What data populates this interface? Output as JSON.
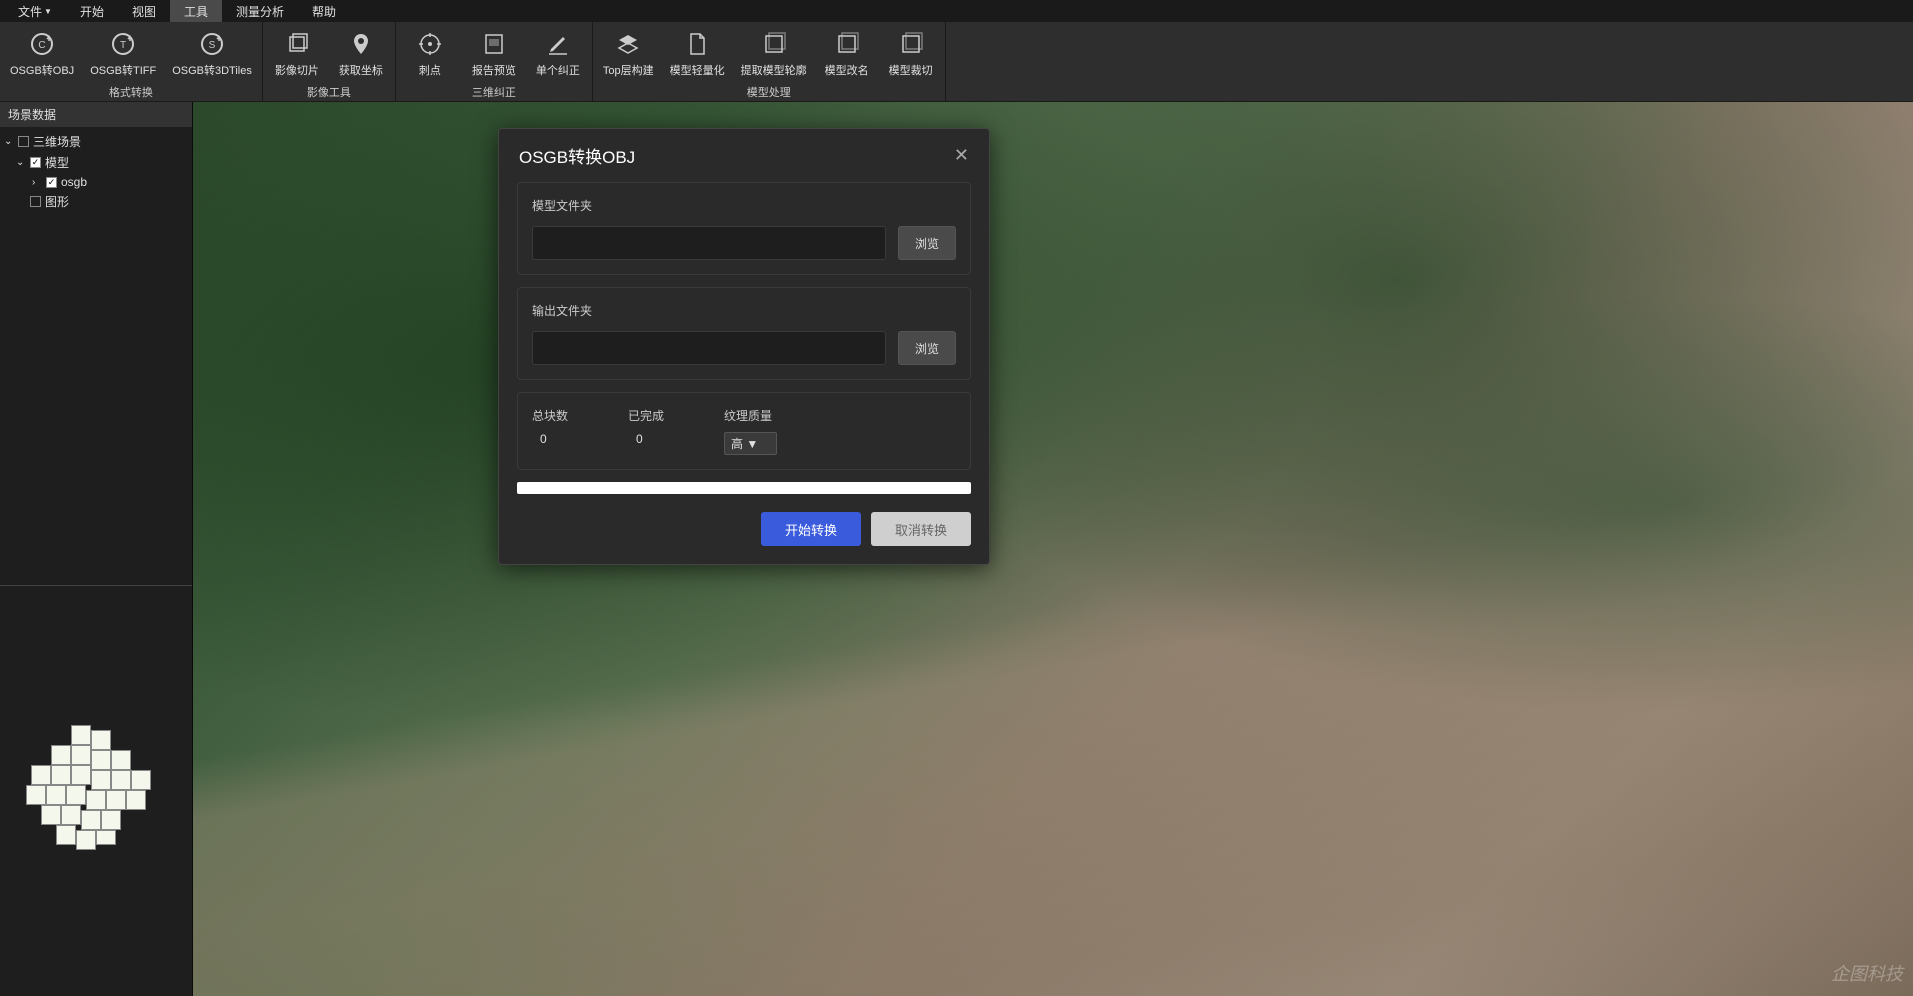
{
  "menubar": {
    "items": [
      "文件",
      "开始",
      "视图",
      "工具",
      "测量分析",
      "帮助"
    ],
    "active_index": 3
  },
  "ribbon": {
    "groups": [
      {
        "label": "格式转换",
        "items": [
          {
            "label": "OSGB转OBJ",
            "icon": "convert-c-icon"
          },
          {
            "label": "OSGB转TIFF",
            "icon": "convert-t-icon"
          },
          {
            "label": "OSGB转3DTiles",
            "icon": "convert-s-icon"
          }
        ]
      },
      {
        "label": "影像工具",
        "items": [
          {
            "label": "影像切片",
            "icon": "layers-icon"
          },
          {
            "label": "获取坐标",
            "icon": "pin-icon"
          }
        ]
      },
      {
        "label": "三维纠正",
        "items": [
          {
            "label": "刺点",
            "icon": "target-icon"
          },
          {
            "label": "报告预览",
            "icon": "report-icon"
          },
          {
            "label": "单个纠正",
            "icon": "pencil-icon"
          }
        ]
      },
      {
        "label": "模型处理",
        "items": [
          {
            "label": "Top层构建",
            "icon": "stack-icon"
          },
          {
            "label": "模型轻量化",
            "icon": "document-icon"
          },
          {
            "label": "提取模型轮廓",
            "icon": "outline-icon"
          },
          {
            "label": "模型改名",
            "icon": "rename-icon"
          },
          {
            "label": "模型裁切",
            "icon": "crop-icon"
          }
        ]
      }
    ]
  },
  "sidebar": {
    "header": "场景数据",
    "tree": [
      {
        "level": 0,
        "expanded": true,
        "checked": false,
        "label": "三维场景"
      },
      {
        "level": 1,
        "expanded": true,
        "checked": true,
        "label": "模型"
      },
      {
        "level": 2,
        "expanded": false,
        "checked": true,
        "label": "osgb",
        "has_children": true
      },
      {
        "level": 1,
        "expanded": false,
        "checked": false,
        "label": "图形"
      }
    ]
  },
  "dialog": {
    "title": "OSGB转换OBJ",
    "model_folder_label": "模型文件夹",
    "model_folder_value": "",
    "output_folder_label": "输出文件夹",
    "output_folder_value": "",
    "browse_label": "浏览",
    "total_blocks_label": "总块数",
    "total_blocks_value": "0",
    "completed_label": "已完成",
    "completed_value": "0",
    "texture_quality_label": "纹理质量",
    "texture_quality_value": "高",
    "start_label": "开始转换",
    "cancel_label": "取消转换"
  },
  "watermark": "企图科技"
}
